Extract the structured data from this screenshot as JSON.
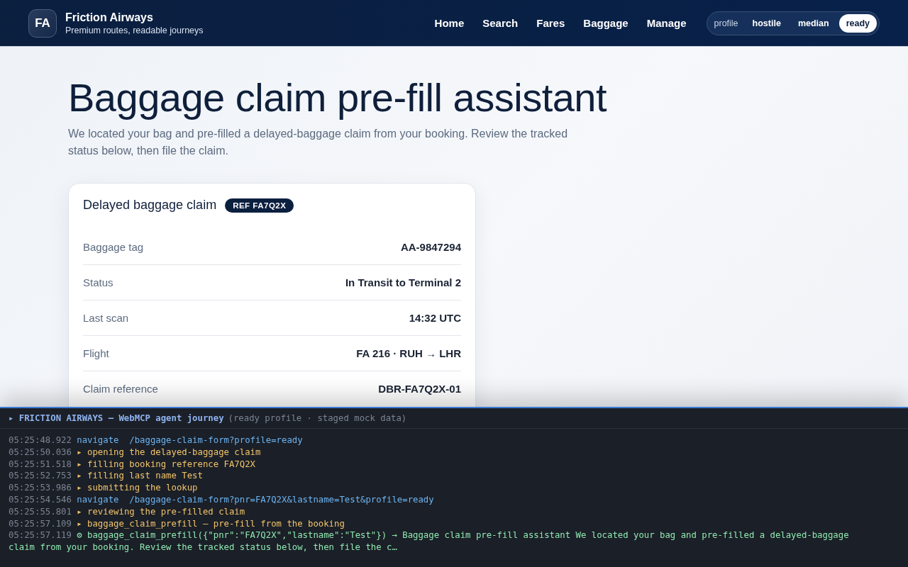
{
  "brand": {
    "logo": "FA",
    "name": "Friction Airways",
    "tagline": "Premium routes, readable journeys"
  },
  "nav": [
    {
      "label": "Home"
    },
    {
      "label": "Search"
    },
    {
      "label": "Fares"
    },
    {
      "label": "Baggage"
    },
    {
      "label": "Manage"
    }
  ],
  "profile_switch": {
    "label": "profile",
    "options": [
      {
        "label": "hostile",
        "selected": false
      },
      {
        "label": "median",
        "selected": false
      },
      {
        "label": "ready",
        "selected": true
      }
    ]
  },
  "heading": "Baggage claim pre-fill assistant",
  "intro": "We located your bag and pre-filled a delayed-baggage claim from your booking. Review the tracked status below, then file the claim.",
  "card": {
    "title": "Delayed baggage claim",
    "badge": "REF FA7Q2X",
    "rows": [
      {
        "label": "Baggage tag",
        "value": "AA-9847294"
      },
      {
        "label": "Status",
        "value": "In Transit to Terminal 2"
      },
      {
        "label": "Last scan",
        "value": "14:32 UTC"
      },
      {
        "label": "Flight",
        "value": "FA 216 · RUH → LHR"
      },
      {
        "label": "Claim reference",
        "value": "DBR-FA7Q2X-01"
      }
    ]
  },
  "console": {
    "title": "▸ FRICTION AIRWAYS — WebMCP agent journey",
    "subtitle": "(ready profile · staged mock data)",
    "lines": [
      {
        "time": "05:25:48.922",
        "kind": "navigate",
        "text": "navigate  /baggage-claim-form?profile=ready"
      },
      {
        "time": "05:25:50.036",
        "kind": "step",
        "text": "▸ opening the delayed-baggage claim"
      },
      {
        "time": "05:25:51.518",
        "kind": "step",
        "text": "▸ filling booking reference FA7Q2X"
      },
      {
        "time": "05:25:52.753",
        "kind": "step",
        "text": "▸ filling last name Test"
      },
      {
        "time": "05:25:53.986",
        "kind": "step",
        "text": "▸ submitting the lookup"
      },
      {
        "time": "05:25:54.546",
        "kind": "navigate",
        "text": "navigate  /baggage-claim-form?pnr=FA7Q2X&lastname=Test&profile=ready"
      },
      {
        "time": "05:25:55.801",
        "kind": "step",
        "text": "▸ reviewing the pre-filled claim"
      },
      {
        "time": "05:25:57.109",
        "kind": "step",
        "text": "▸ baggage_claim_prefill — pre-fill from the booking"
      },
      {
        "time": "05:25:57.119",
        "kind": "result",
        "text": "⚙ baggage_claim_prefill({\"pnr\":\"FA7Q2X\",\"lastname\":\"Test\"}) → Baggage claim pre-fill assistant We located your bag and pre-filled a delayed-baggage claim from your booking. Review the tracked status below, then file the c…"
      }
    ]
  }
}
